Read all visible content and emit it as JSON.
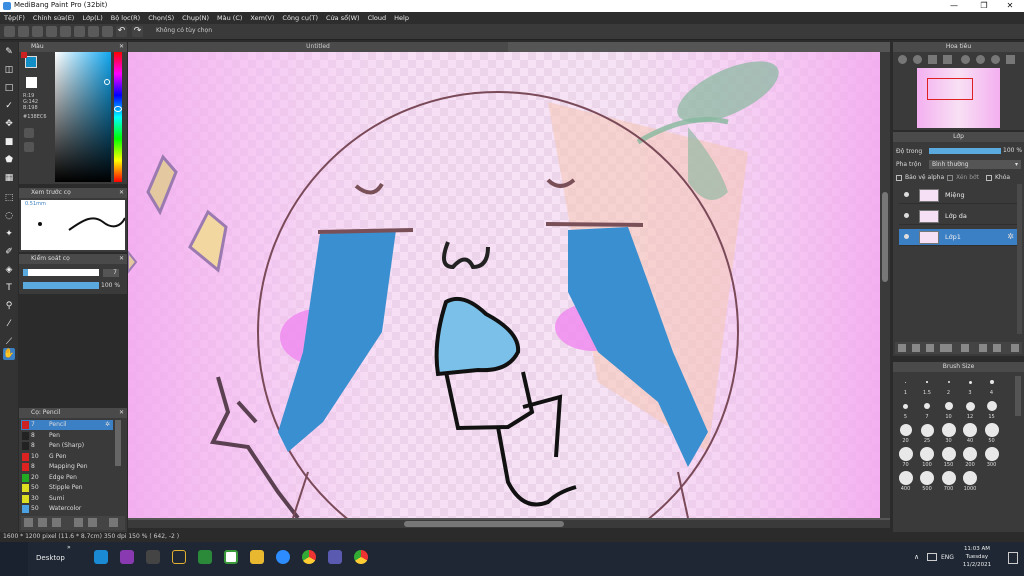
{
  "app": {
    "title": "MediBang Paint Pro (32bit)"
  },
  "window_controls": {
    "minimize": "—",
    "maximize": "❐",
    "close": "✕"
  },
  "menu": [
    "Tệp(F)",
    "Chỉnh sửa(E)",
    "Lớp(L)",
    "Bộ lọc(R)",
    "Chọn(S)",
    "Chụp(N)",
    "Màu (C)",
    "Xem(V)",
    "Công cụ(T)",
    "Cửa sổ(W)",
    "Cloud",
    "Help"
  ],
  "toolbar": {
    "hint": "Không có tùy chọn"
  },
  "panels": {
    "color": {
      "title": "Màu",
      "r": "R:19",
      "g": "G:142",
      "b": "B:198",
      "hex": "#138EC6",
      "fg": "#138ec6"
    },
    "brush_preview": {
      "title": "Xem trước cọ",
      "size": "0.51mm"
    },
    "brush_control": {
      "title": "Kiểm soát cọ",
      "size_value": "7",
      "opacity_value": "100 %",
      "size_fraction": 0.07,
      "opacity_fraction": 1.0
    },
    "brush_list": {
      "title": "Cọ: Pencil",
      "items": [
        {
          "size": "7",
          "name": "Pencil",
          "color": "#cc2222",
          "selected": true
        },
        {
          "size": "8",
          "name": "Pen",
          "color": "#222222",
          "selected": false
        },
        {
          "size": "8",
          "name": "Pen (Sharp)",
          "color": "#222222",
          "selected": false
        },
        {
          "size": "10",
          "name": "G Pen",
          "color": "#dd2222",
          "selected": false
        },
        {
          "size": "8",
          "name": "Mapping Pen",
          "color": "#dd2222",
          "selected": false
        },
        {
          "size": "20",
          "name": "Edge Pen",
          "color": "#22aa22",
          "selected": false
        },
        {
          "size": "50",
          "name": "Stipple Pen",
          "color": "#dddd22",
          "selected": false
        },
        {
          "size": "30",
          "name": "Sumi",
          "color": "#dddd22",
          "selected": false
        },
        {
          "size": "50",
          "name": "Watercolor",
          "color": "#4aa0e0",
          "selected": false
        }
      ]
    },
    "navigator": {
      "title": "Hoa tiêu"
    },
    "layers": {
      "title": "Lớp",
      "opacity_label": "Độ trong",
      "opacity_value": "100 %",
      "opacity_fraction": 1.0,
      "blend_label": "Pha trộn",
      "blend_value": "Bình thường",
      "protect_alpha": "Bảo vệ alpha",
      "clipping": "Xén bớt",
      "lock": "Khóa",
      "items": [
        {
          "name": "Miệng",
          "selected": false
        },
        {
          "name": "Lớp da",
          "selected": false
        },
        {
          "name": "Lớp1",
          "selected": true
        }
      ]
    },
    "brush_size": {
      "title": "Brush Size",
      "sizes": [
        "1",
        "1.5",
        "2",
        "3",
        "4",
        "5",
        "7",
        "10",
        "12",
        "15",
        "20",
        "25",
        "30",
        "40",
        "50",
        "70",
        "100",
        "150",
        "200",
        "300",
        "400",
        "500",
        "700",
        "1000"
      ]
    }
  },
  "document": {
    "tab": "Untitled"
  },
  "status": {
    "text": "1600 * 1200 pixel   (11.6 * 8.7cm)   350 dpi   150 %   ( 642, -2 )"
  },
  "taskbar": {
    "desktop": "Desktop",
    "lang": "ENG",
    "time": "11:03 AM",
    "day": "Tuesday",
    "date": "11/2/2021"
  }
}
